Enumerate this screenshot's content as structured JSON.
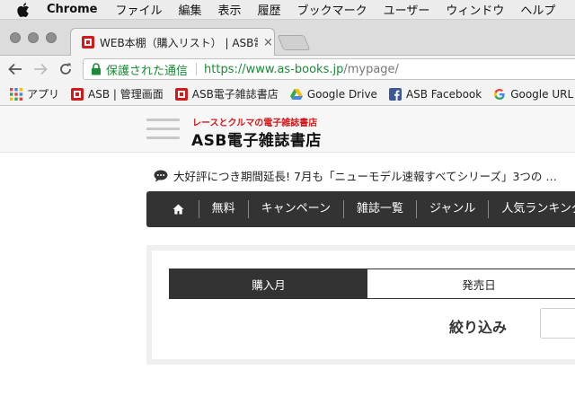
{
  "menubar": {
    "app_name": "Chrome",
    "items": [
      "ファイル",
      "編集",
      "表示",
      "履歴",
      "ブックマーク",
      "ユーザー",
      "ウィンドウ",
      "ヘルプ"
    ]
  },
  "tab": {
    "title": "WEB本棚（購入リスト） | ASB電子雑誌書店",
    "close": "×"
  },
  "omnibox": {
    "secure_label": "保護された通信",
    "url_host": "https://www.as-books.jp",
    "url_path": "/mypage/"
  },
  "bookmarks": [
    {
      "label": "アプリ",
      "icon": "apps-grid-icon"
    },
    {
      "label": "ASB | 管理画面",
      "icon": "asb-favicon"
    },
    {
      "label": "ASB電子雑誌書店",
      "icon": "asb-favicon"
    },
    {
      "label": "Google Drive",
      "icon": "google-drive-icon"
    },
    {
      "label": "ASB Facebook",
      "icon": "facebook-icon"
    },
    {
      "label": "Google URL Shortener",
      "icon": "google-icon"
    }
  ],
  "site": {
    "logo_tagline": "レースとクルマの電子雑誌書店",
    "logo_name": "ASB電子雑誌書店",
    "notice": "大好評につき期間延長! 7月も「ニューモデル速報すべてシリーズ」3つの …",
    "nav_items": [
      "無料",
      "キャンペーン",
      "雑誌一覧",
      "ジャンル",
      "人気ランキング"
    ],
    "sort_tabs": [
      "購入月",
      "発売日"
    ],
    "filter_label": "絞り込み"
  },
  "colors": {
    "secure_green": "#1a8a35",
    "logo_red": "#d11a1a",
    "nav_bg": "#333333"
  }
}
